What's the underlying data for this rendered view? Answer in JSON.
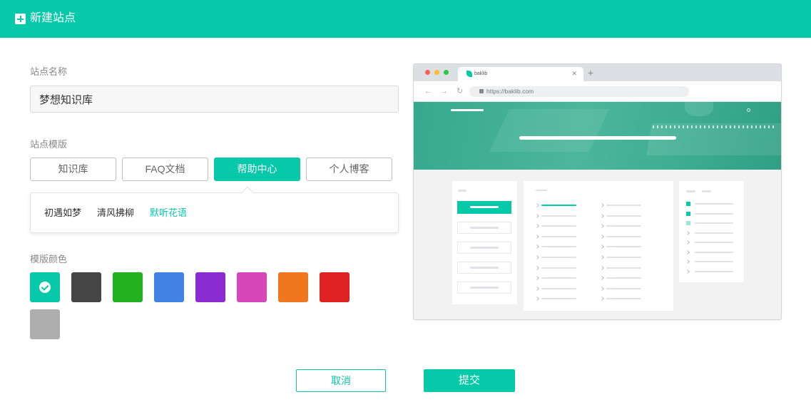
{
  "header": {
    "title": "新建站点"
  },
  "form": {
    "site_name_label": "站点名称",
    "site_name_value": "梦想知识库",
    "template_label": "站点模版",
    "templates": [
      {
        "label": "知识库",
        "active": false
      },
      {
        "label": "FAQ文档",
        "active": false
      },
      {
        "label": "帮助中心",
        "active": true
      },
      {
        "label": "个人博客",
        "active": false
      }
    ],
    "sub_templates": [
      {
        "label": "初遇如梦",
        "active": false
      },
      {
        "label": "清风拂柳",
        "active": false
      },
      {
        "label": "默听花语",
        "active": true
      }
    ],
    "color_label": "模版颜色",
    "colors": [
      {
        "hex": "#05c9a9",
        "selected": true
      },
      {
        "hex": "#454545",
        "selected": false
      },
      {
        "hex": "#22b21f",
        "selected": false
      },
      {
        "hex": "#4182e4",
        "selected": false
      },
      {
        "hex": "#8b2cd2",
        "selected": false
      },
      {
        "hex": "#d846bb",
        "selected": false
      },
      {
        "hex": "#f0771d",
        "selected": false
      },
      {
        "hex": "#e02121",
        "selected": false
      },
      {
        "hex": "#aeaeae",
        "selected": false
      }
    ]
  },
  "preview": {
    "tab_title": "baklib",
    "url": "https://baklib.com"
  },
  "actions": {
    "cancel_label": "取消",
    "submit_label": "提交"
  }
}
